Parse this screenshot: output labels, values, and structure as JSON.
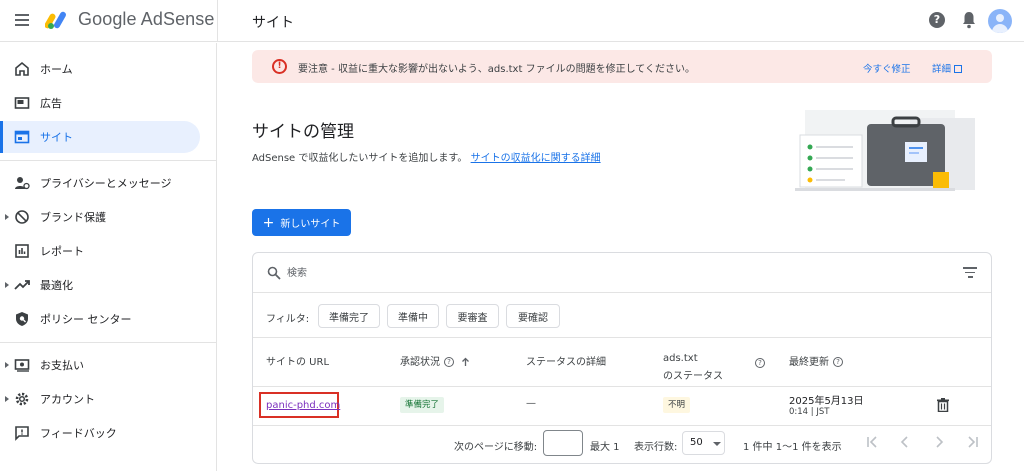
{
  "app": {
    "brand": "Google AdSense",
    "page_title": "サイト"
  },
  "sidebar": {
    "items": [
      {
        "label": "ホーム",
        "icon": "home-icon"
      },
      {
        "label": "広告",
        "icon": "ads-icon"
      },
      {
        "label": "サイト",
        "icon": "sites-icon",
        "active": true
      },
      {
        "label": "プライバシーとメッセージ",
        "icon": "privacy-icon"
      },
      {
        "label": "ブランド保護",
        "icon": "block-icon"
      },
      {
        "label": "レポート",
        "icon": "report-icon"
      },
      {
        "label": "最適化",
        "icon": "trending-icon"
      },
      {
        "label": "ポリシー センター",
        "icon": "policy-shield-icon"
      },
      {
        "label": "お支払い",
        "icon": "payments-icon"
      },
      {
        "label": "アカウント",
        "icon": "gear-icon"
      },
      {
        "label": "フィードバック",
        "icon": "feedback-icon"
      }
    ]
  },
  "alert": {
    "text": "要注意 - 収益に重大な影響が出ないよう、ads.txt ファイルの問題を修正してください。",
    "fix_label": "今すぐ修正",
    "details_label": "詳細"
  },
  "header": {
    "title": "サイトの管理",
    "description": "AdSense で収益化したいサイトを追加します。",
    "link_text": "サイトの収益化に関する詳細"
  },
  "add_button": "新しいサイト",
  "search": {
    "placeholder": "検索"
  },
  "filters": {
    "label": "フィルタ:",
    "chips": [
      "準備完了",
      "準備中",
      "要審査",
      "要確認"
    ]
  },
  "table": {
    "columns": {
      "site_url": "サイトの URL",
      "approval": "承認状況",
      "status_details": "ステータスの詳細",
      "ads_txt_line1": "ads.txt",
      "ads_txt_line2": "のステータス",
      "last_updated": "最終更新"
    },
    "rows": [
      {
        "site": "panic-phd.com",
        "approval": "準備完了",
        "status_details": "—",
        "ads_txt": "不明",
        "updated_date": "2025年5月13日",
        "updated_time": "0:14 | JST"
      }
    ]
  },
  "pagination": {
    "goto_label": "次のページに移動:",
    "max_label": "最大 1",
    "rows_label": "表示行数:",
    "rows_value": "50",
    "range_label": "1 件中 1〜1 件を表示"
  },
  "colors": {
    "accent": "#1a73e8",
    "alert_bg": "#fce8e6",
    "error": "#d93025",
    "ready_bg": "#e6f4ea",
    "ready_text": "#137333",
    "unknown_bg": "#fef7e0"
  }
}
